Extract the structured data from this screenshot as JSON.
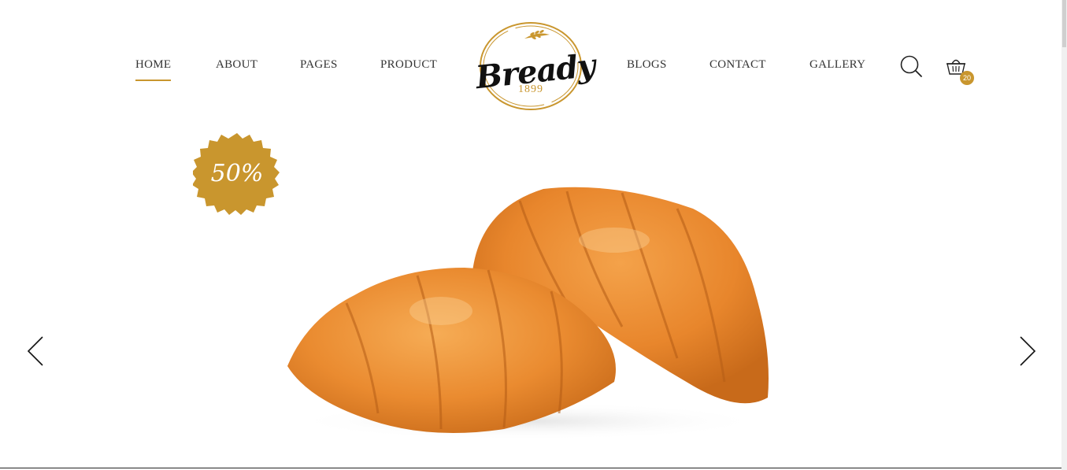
{
  "nav": {
    "left": [
      "HOME",
      "ABOUT",
      "PAGES",
      "PRODUCT"
    ],
    "right": [
      "BLOGS",
      "CONTACT",
      "GALLERY"
    ],
    "active": "HOME"
  },
  "logo": {
    "brand": "Bready",
    "year": "1899"
  },
  "cart": {
    "count": "20"
  },
  "promo": {
    "badge": "50%"
  },
  "icons": {
    "search": "search-icon",
    "cart": "basket-icon",
    "prev": "chevron-left-icon",
    "next": "chevron-right-icon",
    "hero": "croissants-image"
  },
  "colors": {
    "accent": "#c9962e",
    "text": "#333333",
    "background": "#ffffff"
  }
}
